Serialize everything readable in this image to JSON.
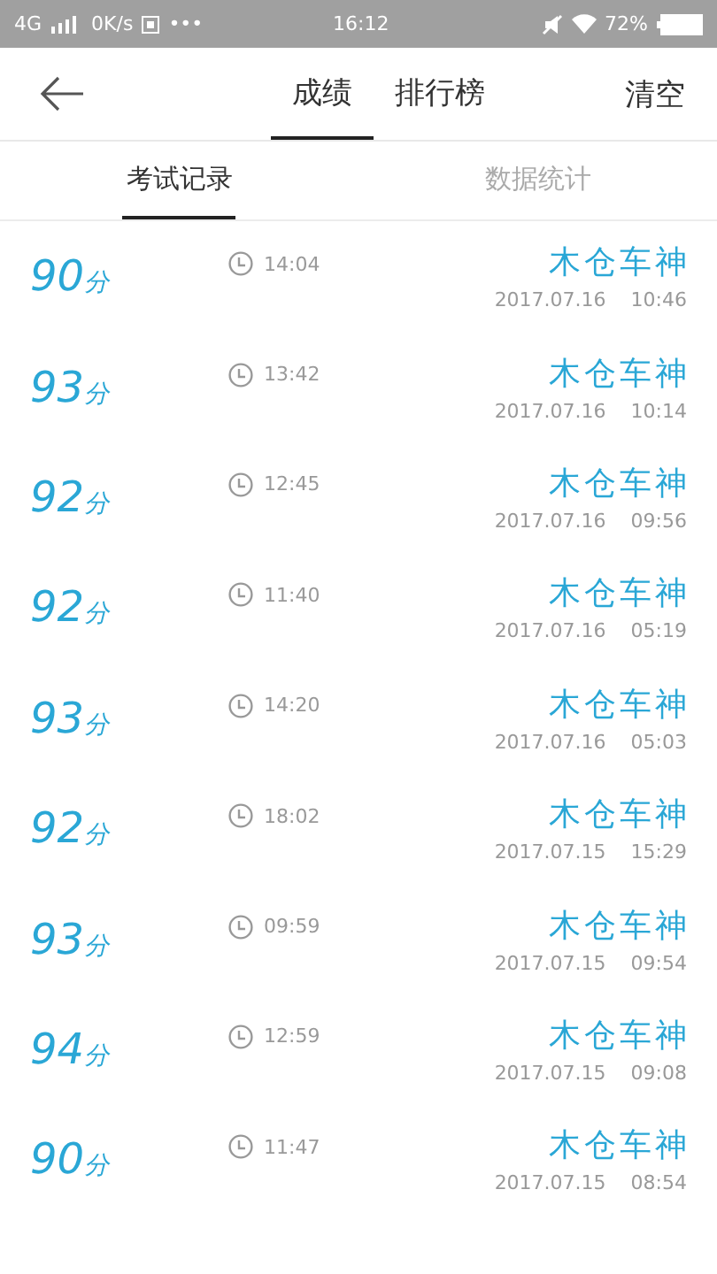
{
  "status_bar": {
    "network": "4G",
    "speed": "0K/s",
    "more": "•••",
    "time": "16:12",
    "battery": "72%"
  },
  "header": {
    "tabs": [
      {
        "label": "成绩",
        "selected": true
      },
      {
        "label": "排行榜",
        "selected": false
      }
    ],
    "action": "清空"
  },
  "sub_tabs": [
    {
      "label": "考试记录",
      "selected": true
    },
    {
      "label": "数据统计",
      "selected": false
    }
  ],
  "records": [
    {
      "score": "90",
      "unit": "分",
      "duration": "14:04",
      "name": "木仓车神",
      "date": "2017.07.16",
      "time": "10:46"
    },
    {
      "score": "93",
      "unit": "分",
      "duration": "13:42",
      "name": "木仓车神",
      "date": "2017.07.16",
      "time": "10:14"
    },
    {
      "score": "92",
      "unit": "分",
      "duration": "12:45",
      "name": "木仓车神",
      "date": "2017.07.16",
      "time": "09:56"
    },
    {
      "score": "92",
      "unit": "分",
      "duration": "11:40",
      "name": "木仓车神",
      "date": "2017.07.16",
      "time": "05:19"
    },
    {
      "score": "93",
      "unit": "分",
      "duration": "14:20",
      "name": "木仓车神",
      "date": "2017.07.16",
      "time": "05:03"
    },
    {
      "score": "92",
      "unit": "分",
      "duration": "18:02",
      "name": "木仓车神",
      "date": "2017.07.15",
      "time": "15:29"
    },
    {
      "score": "93",
      "unit": "分",
      "duration": "09:59",
      "name": "木仓车神",
      "date": "2017.07.15",
      "time": "09:54"
    },
    {
      "score": "94",
      "unit": "分",
      "duration": "12:59",
      "name": "木仓车神",
      "date": "2017.07.15",
      "time": "09:08"
    },
    {
      "score": "90",
      "unit": "分",
      "duration": "11:47",
      "name": "木仓车神",
      "date": "2017.07.15",
      "time": "08:54"
    }
  ]
}
